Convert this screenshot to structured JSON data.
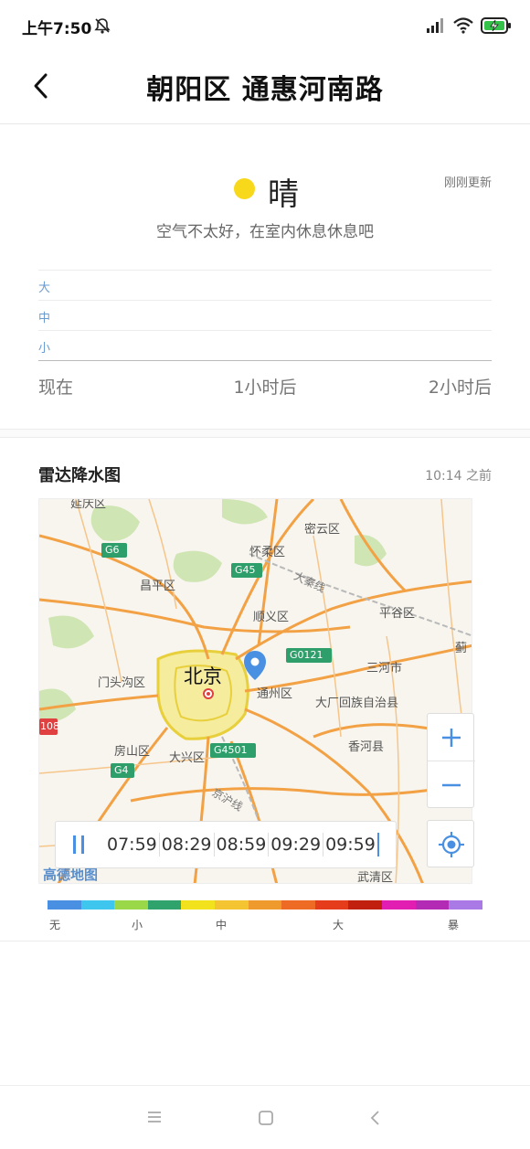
{
  "status_bar": {
    "time": "上午7:50",
    "icons": [
      "mute-icon",
      "signal-icon",
      "wifi-icon",
      "battery-charging-icon"
    ]
  },
  "header": {
    "title": "朝阳区 通惠河南路",
    "back_icon": "chevron-left-icon"
  },
  "weather": {
    "condition": "晴",
    "condition_color": "#f7d81a",
    "updated": "刚刚更新",
    "air_quality": "空气不太好，在室内休息休息吧",
    "intensity_levels": [
      "大",
      "中",
      "小"
    ],
    "timeline": [
      "现在",
      "1小时后",
      "2小时后"
    ]
  },
  "radar": {
    "title": "雷达降水图",
    "time": "10:14 之前",
    "map_labels": {
      "city": "北京",
      "districts": [
        "延庆区",
        "密云区",
        "怀柔区",
        "昌平区",
        "顺义区",
        "平谷区",
        "门头沟区",
        "通州区",
        "三河市",
        "大厂回族自治县",
        "房山区",
        "大兴区",
        "香河县",
        "武清区",
        "蓟"
      ],
      "roads": [
        "G6",
        "G45",
        "G0121",
        "G4501",
        "G4",
        "大秦线",
        "京沪线",
        "108"
      ],
      "watermark": "高德地图"
    },
    "frames": [
      "07:59",
      "08:29",
      "08:59",
      "09:29",
      "09:59"
    ],
    "controls": {
      "zoom_in": "+",
      "zoom_out": "−"
    },
    "legend_colors": [
      "#4a90e2",
      "#3ec6ef",
      "#9ad84a",
      "#2fa36b",
      "#f2e21d",
      "#f5c433",
      "#ef9a2c",
      "#ee6b26",
      "#e53c1c",
      "#c2200f",
      "#e21db2",
      "#b32ab4",
      "#a97ae6"
    ],
    "legend_labels": [
      "无",
      "小",
      "中",
      "大",
      "暴"
    ],
    "accent_color": "#4a90e2"
  },
  "navbar": {
    "icons": [
      "menu-icon",
      "home-icon",
      "back-icon"
    ]
  }
}
